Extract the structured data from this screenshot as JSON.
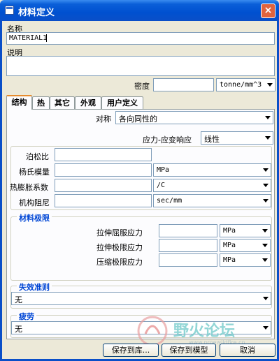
{
  "window": {
    "title": "材料定义",
    "close_label": "×"
  },
  "form": {
    "name_label": "名称",
    "name_value": "MATERIAL1",
    "desc_label": "说明",
    "desc_value": "",
    "density_label": "密度",
    "density_value": "",
    "density_unit": "tonne/mm^3"
  },
  "tabs": [
    {
      "label": "结构",
      "active": true
    },
    {
      "label": "热",
      "active": false
    },
    {
      "label": "其它",
      "active": false
    },
    {
      "label": "外观",
      "active": false
    },
    {
      "label": "用户定义",
      "active": false
    }
  ],
  "structure": {
    "symmetry_label": "对称",
    "symmetry_value": "各向同性的",
    "stress_strain_label": "应力-应变响应",
    "stress_strain_value": "线性",
    "properties": [
      {
        "label": "泊松比",
        "value": "",
        "unit": ""
      },
      {
        "label": "杨氏模量",
        "value": "",
        "unit": "MPa"
      },
      {
        "label": "热膨胀系数",
        "value": "",
        "unit": "/C"
      },
      {
        "label": "机构阻尼",
        "value": "",
        "unit": "sec/mm"
      }
    ],
    "limits_title": "材料极限",
    "limits": [
      {
        "label": "拉伸屈服应力",
        "value": "",
        "unit": "MPa"
      },
      {
        "label": "拉伸极限应力",
        "value": "",
        "unit": "MPa"
      },
      {
        "label": "压缩极限应力",
        "value": "",
        "unit": "MPa"
      }
    ],
    "failure_title": "失效准则",
    "failure_value": "无",
    "fatigue_title": "疲劳",
    "fatigue_value": "无"
  },
  "buttons": {
    "save_library": "保存到库...",
    "save_model": "保存到模型",
    "cancel": "取消"
  },
  "watermark": {
    "text": "野火论坛",
    "subtext": "www.proewildfire.cn"
  },
  "colors": {
    "titlebar": "#0a5fd8",
    "group_title": "#0046d5",
    "tab_accent": "#e68b2c"
  }
}
